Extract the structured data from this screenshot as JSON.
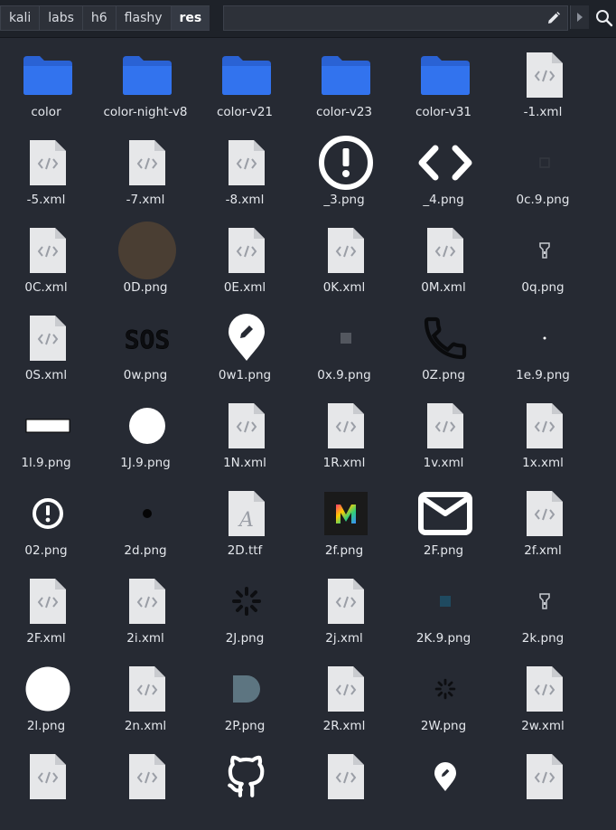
{
  "breadcrumb": [
    "kali",
    "labs",
    "h6",
    "flashy",
    "res"
  ],
  "active_crumb": "res",
  "colors": {
    "folder": "#2f6ee8",
    "doc": "#e6e7e9",
    "bg": "#262a33"
  },
  "files": [
    {
      "name": "color",
      "icon": "folder-icon"
    },
    {
      "name": "color-night-v8",
      "icon": "folder-icon"
    },
    {
      "name": "color-v21",
      "icon": "folder-icon"
    },
    {
      "name": "color-v23",
      "icon": "folder-icon"
    },
    {
      "name": "color-v31",
      "icon": "folder-icon"
    },
    {
      "name": "-1.xml",
      "icon": "xml-file-icon"
    },
    {
      "name": "-5.xml",
      "icon": "xml-file-icon"
    },
    {
      "name": "-7.xml",
      "icon": "xml-file-icon"
    },
    {
      "name": "-8.xml",
      "icon": "xml-file-icon"
    },
    {
      "name": "_3.png",
      "icon": "alert-circle-outline-icon"
    },
    {
      "name": "_4.png",
      "icon": "code-brackets-icon"
    },
    {
      "name": "0c.9.png",
      "icon": "tiny-dark-square-icon"
    },
    {
      "name": "0C.xml",
      "icon": "xml-file-icon"
    },
    {
      "name": "0D.png",
      "icon": "brown-circle-icon"
    },
    {
      "name": "0E.xml",
      "icon": "xml-file-icon"
    },
    {
      "name": "0K.xml",
      "icon": "xml-file-icon"
    },
    {
      "name": "0M.xml",
      "icon": "xml-file-icon"
    },
    {
      "name": "0q.png",
      "icon": "flashlight-small-icon"
    },
    {
      "name": "0S.xml",
      "icon": "xml-file-icon"
    },
    {
      "name": "0w.png",
      "icon": "sos-text-icon"
    },
    {
      "name": "0w1.png",
      "icon": "map-pin-pencil-icon"
    },
    {
      "name": "0x.9.png",
      "icon": "small-gray-square-icon"
    },
    {
      "name": "0Z.png",
      "icon": "phone-icon"
    },
    {
      "name": "1e.9.png",
      "icon": "tiny-dot-icon"
    },
    {
      "name": "1l.9.png",
      "icon": "white-bar-icon"
    },
    {
      "name": "1J.9.png",
      "icon": "white-circle-icon"
    },
    {
      "name": "1N.xml",
      "icon": "xml-file-icon"
    },
    {
      "name": "1R.xml",
      "icon": "xml-file-icon"
    },
    {
      "name": "1v.xml",
      "icon": "xml-file-icon"
    },
    {
      "name": "1x.xml",
      "icon": "xml-file-icon"
    },
    {
      "name": "02.png",
      "icon": "alert-circle-filled-icon"
    },
    {
      "name": "2d.png",
      "icon": "black-dot-icon"
    },
    {
      "name": "2D.ttf",
      "icon": "font-file-icon"
    },
    {
      "name": "2f.png",
      "icon": "gradient-m-logo-icon"
    },
    {
      "name": "2F.png",
      "icon": "envelope-icon"
    },
    {
      "name": "2f.xml",
      "icon": "xml-file-icon"
    },
    {
      "name": "2F.xml",
      "icon": "xml-file-icon"
    },
    {
      "name": "2i.xml",
      "icon": "xml-file-icon"
    },
    {
      "name": "2J.png",
      "icon": "spinner-icon"
    },
    {
      "name": "2j.xml",
      "icon": "xml-file-icon"
    },
    {
      "name": "2K.9.png",
      "icon": "small-teal-square-icon"
    },
    {
      "name": "2k.png",
      "icon": "flashlight-small-icon"
    },
    {
      "name": "2l.png",
      "icon": "large-white-circle-icon"
    },
    {
      "name": "2n.xml",
      "icon": "xml-file-icon"
    },
    {
      "name": "2P.png",
      "icon": "slate-rounded-shape-icon"
    },
    {
      "name": "2R.xml",
      "icon": "xml-file-icon"
    },
    {
      "name": "2W.png",
      "icon": "spinner-small-icon"
    },
    {
      "name": "2w.xml",
      "icon": "xml-file-icon"
    },
    {
      "name": "",
      "icon": "xml-file-icon"
    },
    {
      "name": "",
      "icon": "xml-file-icon"
    },
    {
      "name": "",
      "icon": "github-icon"
    },
    {
      "name": "",
      "icon": "xml-file-icon"
    },
    {
      "name": "",
      "icon": "map-pin-pencil-small-icon"
    },
    {
      "name": "",
      "icon": "xml-file-icon"
    }
  ]
}
